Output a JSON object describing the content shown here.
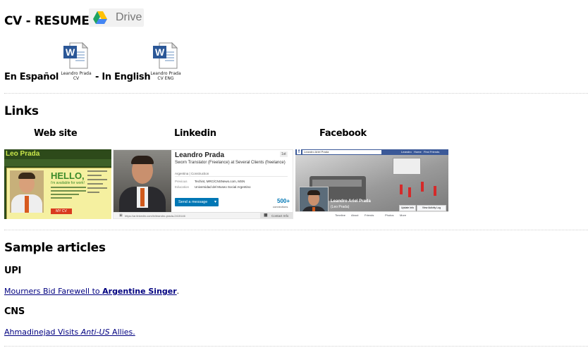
{
  "cv": {
    "title": "CV - RESUME",
    "drive_label": "Drive",
    "spanish_label": "En Español",
    "english_label": "- In English",
    "doc_es_line1": "Leandro Prada",
    "doc_es_line2": "CV",
    "doc_en_line1": "Leandro Prada",
    "doc_en_line2": "CV ENG",
    "word_letter": "W"
  },
  "links": {
    "title": "Links",
    "website_label": "Web site",
    "linkedin_label": "Linkedin",
    "facebook_label": "Facebook",
    "website": {
      "brand": "Leo Prada",
      "hello": "HELLO,",
      "sub": "i'm available for work!",
      "cv_button": "MY CV"
    },
    "linkedin": {
      "name": "Leandro Prada",
      "headline": "Sworn Translator (Freelance) at Several Clients (freelance)",
      "location": "Argentina",
      "industry": "Construction",
      "previous_label": "Previous",
      "previous": "Techint, MRC/CNSNews.com, MSN",
      "education_label": "Education",
      "education": "Universidad del Museo Social Argentino",
      "send_button": "Send a message",
      "connections": "500+",
      "connections_label": "connections",
      "url": "https://ar.linkedin.com/in/leandro-prada-2415146",
      "contact_info": "Contact Info",
      "badge": "1st"
    },
    "facebook": {
      "search_text": "Leandro Ariel Prada",
      "profile_name": "Leandro Ariel Prada",
      "nickname": "(Leo Prada)",
      "update_info": "Update Info",
      "view_activity": "View Activity Log",
      "nav": [
        "Timeline",
        "About",
        "Friends",
        "Photos",
        "More"
      ],
      "top_user": "Leandro",
      "home": "Home",
      "find_friends": "Find Friends"
    }
  },
  "articles": {
    "title": "Sample articles",
    "upi_label": "UPI",
    "upi_text": "Mourners Bid Farewell to ",
    "upi_bold": "Argentine Singer",
    "upi_end": ".",
    "cns_label": "CNS",
    "cns_text1": "Ahmadinejad Visits ",
    "cns_italic": "Anti-US",
    "cns_text2": " Allies."
  },
  "colors": {
    "link": "#000080",
    "facebook_blue": "#3b5998",
    "linkedin_blue": "#0077b5",
    "website_green": "#2d4a1a",
    "website_yellow": "#f5f0a0"
  }
}
